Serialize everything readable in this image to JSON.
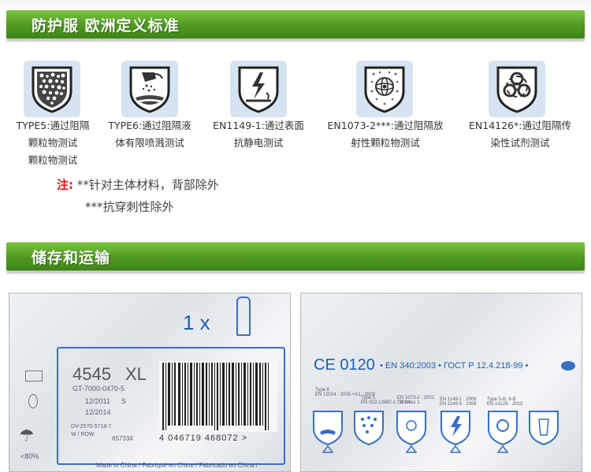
{
  "section1": {
    "title": "防护服 欧洲定义标准"
  },
  "standards": [
    {
      "icon": "particle-shield-icon",
      "line1": "TYPE5:通过阻隔",
      "line2": "颗粒物测试",
      "line3": "颗粒物测试"
    },
    {
      "icon": "liquid-spray-shield-icon",
      "line1": "TYPE6:通过阻隔液",
      "line2": "体有限喷溅测试"
    },
    {
      "icon": "antistatic-shield-icon",
      "line1": "EN1149-1:通过表面",
      "line2": "抗静电测试"
    },
    {
      "icon": "radioactive-particle-shield-icon",
      "line1": "EN1073-2***:通过阻隔放",
      "line2": "射性颗粒物测试"
    },
    {
      "icon": "biohazard-shield-icon",
      "line1": "EN14126*:通过阻隔传",
      "line2": "染性试剂测试"
    }
  ],
  "note": {
    "label": "注:",
    "line1": " **针对主体材料，背部除外",
    "line2": "***抗穿刺性除外"
  },
  "section2": {
    "title": "储存和运输"
  },
  "package_left": {
    "count": "1 x",
    "model": "4545",
    "size": "XL",
    "code": "GT-7000-0470-5",
    "date1": "12/2011",
    "date1_suffix": "S",
    "date2": "12/2014",
    "ref1": "DV-2570-5718-7",
    "ref2": "W / ROW",
    "ref3": "657334",
    "barcode_number": "4 046719 468072 >",
    "humidity": "<80%",
    "origin": "Made in China / Fabriqué en Chine / Fabricado en China /"
  },
  "package_right": {
    "ce_mark": "CE 0120",
    "standard_line": "• EN 340:2003 • ГОСТ Р 12.4.218-99 •",
    "labels": [
      {
        "name": "Type 6",
        "sub": "EN 13034 : 2005 +A1 : 2009"
      },
      {
        "name": "Type 5",
        "sub": "EN ISO 13982-1 : 2004"
      },
      {
        "name": "EN 1073-2 : 2002",
        "sub": "TIL class 1"
      },
      {
        "name": "EN 1149-1 : 2006",
        "sub": "EN 1149-5 : 2008"
      },
      {
        "name": "Type 5-B, 6-B",
        "sub": "EN 14126 : 2003"
      }
    ]
  },
  "colors": {
    "banner": "#4f9a22",
    "icon_bg": "#d6e4f2",
    "note_red": "#e01010",
    "package_blue": "#1f5fb0"
  }
}
